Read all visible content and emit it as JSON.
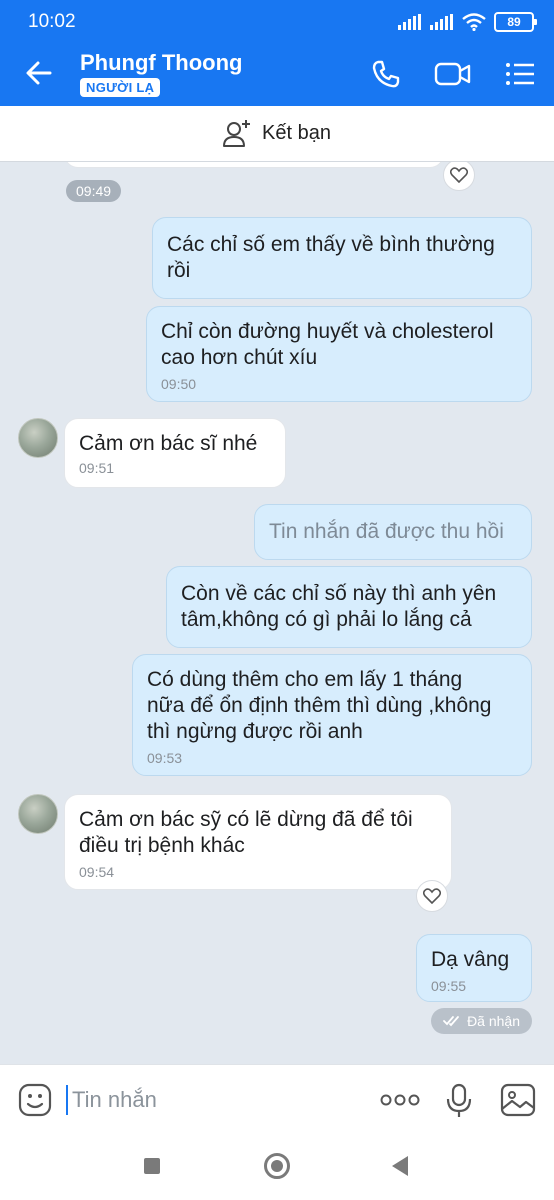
{
  "status_bar": {
    "time": "10:02",
    "battery": "89"
  },
  "header": {
    "contact_name": "Phungf Thoong",
    "badge": "NGƯỜI LẠ"
  },
  "add_friend": {
    "label": "Kết bạn"
  },
  "messages": [
    {
      "id": "top-time",
      "time": "09:49"
    },
    {
      "id": "m1",
      "direction": "out",
      "text_lines": [
        "Các chỉ số em thấy về bình thường",
        "rồi"
      ]
    },
    {
      "id": "m2",
      "direction": "out",
      "text_lines": [
        "Chỉ còn đường huyết và cholesterol",
        "cao hơn chút xíu"
      ],
      "time": "09:50"
    },
    {
      "id": "m3",
      "direction": "in",
      "text_lines": [
        "Cảm ơn bác sĩ nhé"
      ],
      "time": "09:51"
    },
    {
      "id": "m4",
      "direction": "out",
      "recalled": true,
      "text_lines": [
        "Tin nhắn đã được thu hồi"
      ]
    },
    {
      "id": "m5",
      "direction": "out",
      "text_lines": [
        "Còn về các chỉ số này thì anh yên",
        "tâm,không có gì phải lo lắng cả"
      ]
    },
    {
      "id": "m6",
      "direction": "out",
      "text_lines": [
        "Có dùng thêm cho em lấy 1 tháng",
        "nữa để ổn định thêm thì dùng ,không",
        "thì ngừng được rồi anh"
      ],
      "time": "09:53"
    },
    {
      "id": "m7",
      "direction": "in",
      "text_lines": [
        "Cảm ơn bác sỹ có lẽ dừng đã để tôi",
        "điều trị bệnh khác"
      ],
      "time": "09:54"
    },
    {
      "id": "m8",
      "direction": "out",
      "text_lines": [
        "Dạ vâng"
      ],
      "time": "09:55"
    }
  ],
  "receipt": {
    "label": "Đã nhận"
  },
  "input": {
    "placeholder": "Tin nhắn"
  },
  "colors": {
    "header_bg": "#1877f2",
    "chat_bg": "#e2e8ef",
    "outgoing_bubble": "#d7edfd",
    "incoming_bubble": "#ffffff"
  },
  "icons": {
    "header": [
      "back-arrow-icon",
      "phone-icon",
      "video-call-icon",
      "menu-list-icon"
    ],
    "add_friend": "add-person-icon",
    "input_bar": [
      "emoji-icon",
      "more-dots-icon",
      "microphone-icon",
      "image-icon"
    ],
    "nav": [
      "recent-apps-icon",
      "home-icon",
      "back-icon"
    ]
  }
}
